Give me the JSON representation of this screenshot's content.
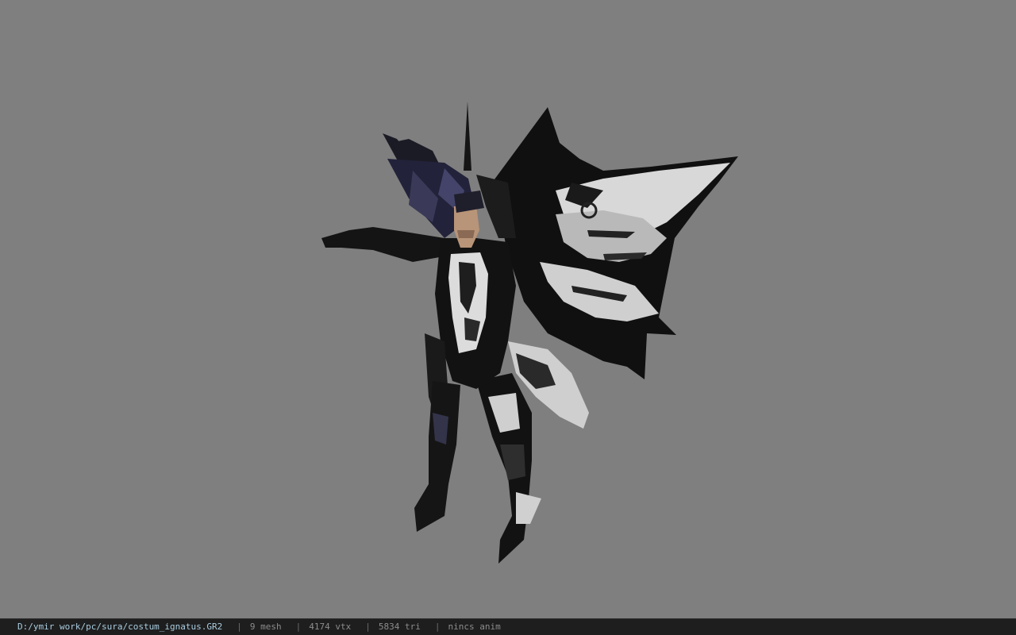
{
  "viewer": {
    "background_color": "#7f7f7f",
    "model_subject": "winged armored character model",
    "status_bar": {
      "file_path": "D:/ymir work/pc/sura/costum_ignatus.GR2",
      "separator": "|",
      "mesh_count": "9 mesh",
      "vertex_count": "4174 vtx",
      "triangle_count": "5834 tri",
      "animation_status": "nincs anim"
    }
  }
}
